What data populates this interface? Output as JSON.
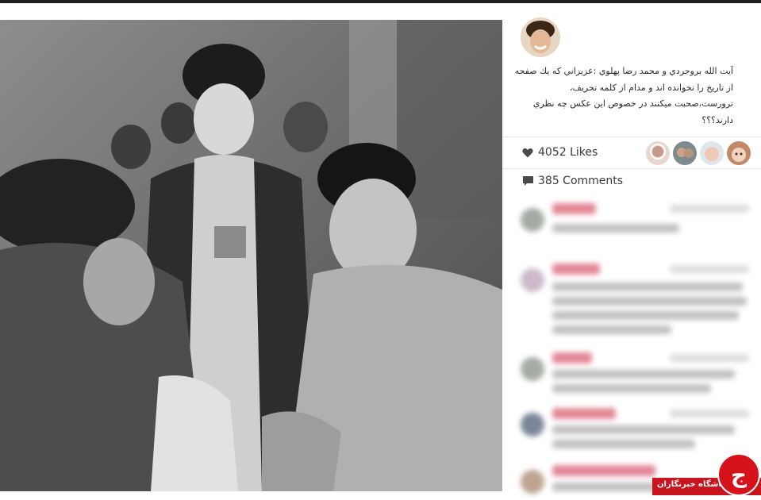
{
  "post": {
    "caption": "آيت الله بروجردي و محمد رضا پهلوي :عزيزاني كه يك صفحه از تاريخ را نخوانده اند و مدام از كلمه تحريف، ترورست،صحبت ميكنند در خصوص اين عكس چه نظري دارند؟؟؟",
    "likes": "4052 Likes",
    "comments": "385 Comments"
  },
  "icons": {
    "likes": "heart-icon",
    "comments": "speech-bubble-icon",
    "badge": "news-club-logo-icon"
  },
  "colors": {
    "accent": "#d6121b",
    "text": "#3a3a3a"
  },
  "badge": {
    "label": "باشگاه خبرنگاران"
  }
}
